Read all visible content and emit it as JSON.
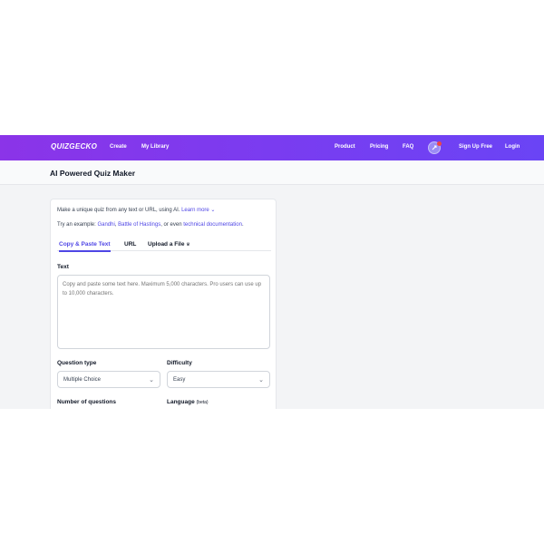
{
  "nav": {
    "logo": "QUIZGECKO",
    "create": "Create",
    "library": "My Library",
    "product": "Product",
    "pricing": "Pricing",
    "faq": "FAQ",
    "signup": "Sign Up Free",
    "login": "Login"
  },
  "header": {
    "title": "AI Powered Quiz Maker"
  },
  "card": {
    "intro_text": "Make a unique quiz from any text or URL, using AI.",
    "learn_more": "Learn more ⌄",
    "example_prefix": "Try an example:",
    "example_1": "Gandhi",
    "example_2": "Battle of Hastings",
    "example_mid": ", or even",
    "example_3": "technical documentation",
    "tabs": [
      "Copy & Paste Text",
      "URL",
      "Upload a File"
    ],
    "text_label": "Text",
    "text_placeholder": "Copy and paste some text here. Maximum 5,000 characters. Pro users can use up to 10,000 characters.",
    "question_type_label": "Question type",
    "question_type_value": "Multiple Choice",
    "difficulty_label": "Difficulty",
    "difficulty_value": "Easy",
    "num_questions_label": "Number of questions",
    "language_label": "Language",
    "language_beta": "(beta)"
  },
  "colors": {
    "accent": "#4f46e5",
    "nav_start": "#8b34e8",
    "nav_end": "#6a44f5"
  },
  "icons": {
    "badge": "rocket-icon",
    "chevron": "chevron-down-icon",
    "upload": "crown-icon"
  }
}
